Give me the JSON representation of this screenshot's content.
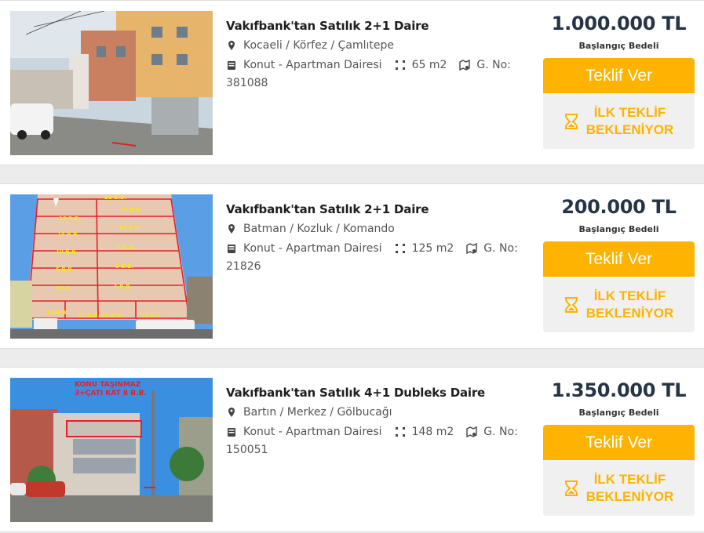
{
  "listings": [
    {
      "title": "Vakıfbank'tan Satılık 2+1 Daire",
      "location": "Kocaeli / Körfez / Çamlıtepe",
      "type": "Konut - Apartman Dairesi",
      "area": "65 m2",
      "gno_label": "G. No:",
      "gno": "381088",
      "price": "1.000.000 TL",
      "price_label": "Başlangıç Bedeli",
      "offer_label": "Teklif Ver",
      "status": "İLK TEKLİF\nBEKLENİYOR",
      "photo": {
        "annotation": ""
      }
    },
    {
      "title": "Vakıfbank'tan Satılık 2+1 Daire",
      "location": "Batman / Kozluk / Komando",
      "type": "Konut - Apartman Dairesi",
      "area": "125 m2",
      "gno_label": "G. No:",
      "gno": "21826",
      "price": "200.000 TL",
      "price_label": "Başlangıç Bedeli",
      "offer_label": "Teklif Ver",
      "status": "İLK TEKLİF\nBEKLENİYOR",
      "photo": {
        "annotation": "21 B.B.",
        "units": [
          "18 B.B.",
          "17 B.B.",
          "14 B.B.",
          "13 B.B.",
          "10 B.B.",
          "9 B.B.",
          "6 B.B.",
          "5 B.B.",
          "2 B.B.",
          "1 B.B.",
          "28 B.B.",
          "27 B.B.",
          "26 B.B.",
          "25 B.B."
        ]
      }
    },
    {
      "title": "Vakıfbank'tan Satılık 4+1 Dubleks Daire",
      "location": "Bartın / Merkez / Gölbucağı",
      "type": "Konut - Apartman Dairesi",
      "area": "148 m2",
      "gno_label": "G. No:",
      "gno": "150051",
      "price": "1.350.000 TL",
      "price_label": "Başlangıç Bedeli",
      "offer_label": "Teklif Ver",
      "status": "İLK TEKLİF\nBEKLENİYOR",
      "photo": {
        "annotation_line1": "KONU TAŞINMAZ",
        "annotation_line2": "3+ÇATI KAT 8 B.B."
      }
    }
  ],
  "colors": {
    "accent": "#fdb300",
    "price": "#263445",
    "status_bg": "#f0f0f0"
  },
  "icons": {
    "location": "map-pin-icon",
    "type": "building-icon",
    "area": "area-icon",
    "gno": "map-icon",
    "status": "hourglass-icon"
  }
}
